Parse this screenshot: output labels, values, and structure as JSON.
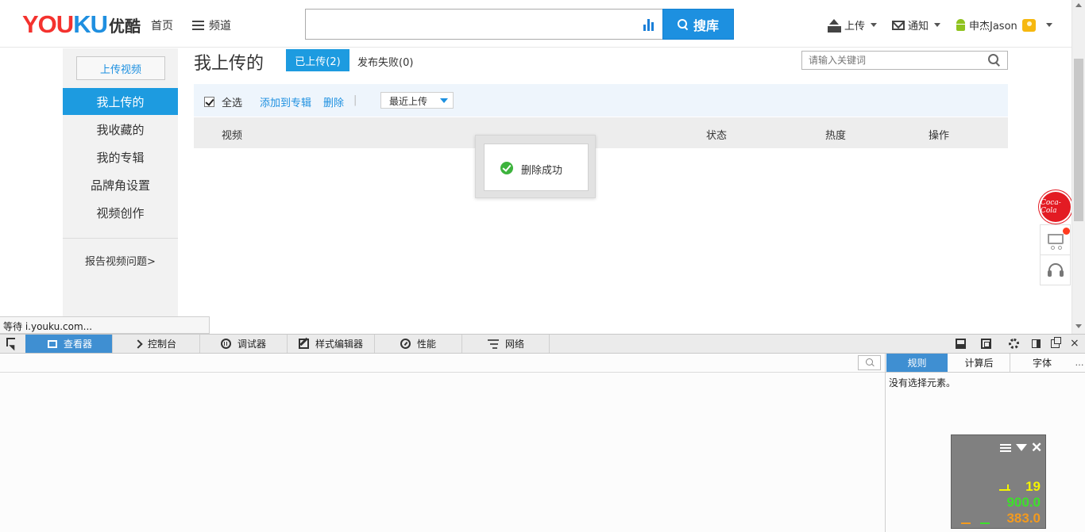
{
  "header": {
    "logo_en_1": "YOU",
    "logo_en_2": "KU",
    "logo_cn": "优酷",
    "nav_home": "首页",
    "nav_channel": "频道",
    "search_value": "",
    "search_button": "搜库",
    "upload": "上传",
    "notify": "通知",
    "user": "申杰Jason"
  },
  "sidebar": {
    "upload_button": "上传视频",
    "items": [
      {
        "label": "我上传的",
        "active": true
      },
      {
        "label": "我收藏的",
        "active": false
      },
      {
        "label": "我的专辑",
        "active": false
      },
      {
        "label": "品牌角设置",
        "active": false
      },
      {
        "label": "视频创作",
        "active": false
      }
    ],
    "report": "报告视频问题>"
  },
  "main": {
    "title": "我上传的",
    "tab_uploaded": "已上传(2)",
    "tab_failed": "发布失败(0)",
    "keyword_placeholder": "请输入关键词",
    "select_all": "全选",
    "add_to_album": "添加到专辑",
    "delete": "删除",
    "separator": "|",
    "sort_selected": "最近上传",
    "columns": {
      "video": "视频",
      "status": "状态",
      "heat": "热度",
      "action": "操作"
    }
  },
  "toast": {
    "message": "删除成功"
  },
  "floating": {
    "coke_text": "Coca-Cola"
  },
  "status_bar": {
    "text": "等待 i.youku.com..."
  },
  "devtools": {
    "tabs": [
      {
        "label": "查看器",
        "icon": "inspector-icon",
        "active": true
      },
      {
        "label": "控制台",
        "icon": "console-icon",
        "active": false
      },
      {
        "label": "调试器",
        "icon": "debugger-icon",
        "active": false
      },
      {
        "label": "样式编辑器",
        "icon": "style-editor-icon",
        "active": false
      },
      {
        "label": "性能",
        "icon": "performance-icon",
        "active": false
      },
      {
        "label": "网络",
        "icon": "network-icon",
        "active": false
      }
    ],
    "close_glyph": "×",
    "rules_tabs": [
      "规则",
      "计算后",
      "字体"
    ],
    "rules_empty": "没有选择元素。"
  },
  "perf_meter": {
    "fps": "19",
    "memory": "900.0",
    "ms": "383.0",
    "close_glyph": "✕"
  },
  "colors": {
    "brand_blue": "#1d90e0",
    "active_blue": "#1d9be0",
    "devtools_active": "#3f8fd2",
    "success_green": "#3db33d"
  }
}
